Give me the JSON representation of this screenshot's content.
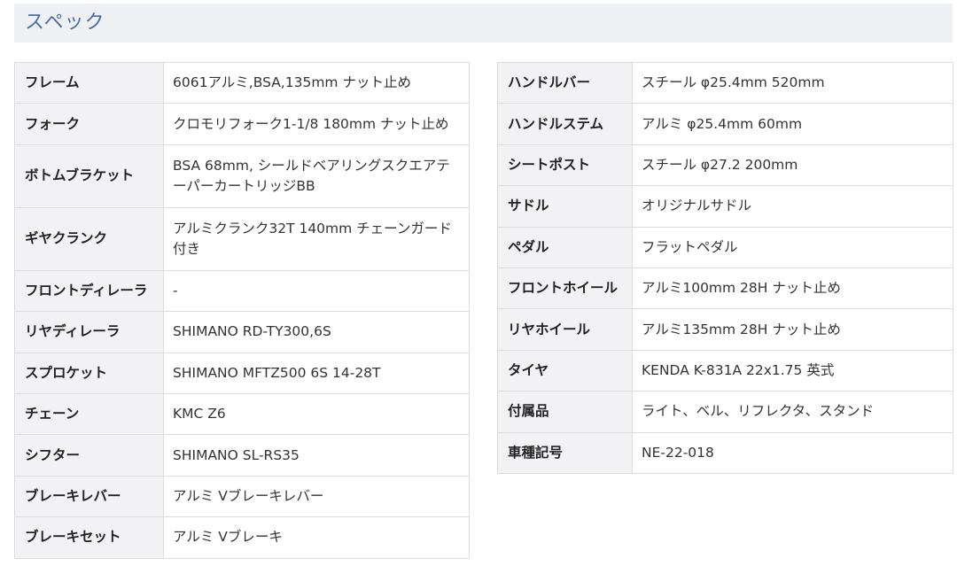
{
  "section": {
    "title": "スペック"
  },
  "left_table": [
    {
      "label": "フレーム",
      "value": "6061アルミ,BSA,135mm ナット止め"
    },
    {
      "label": "フォーク",
      "value": "クロモリフォーク1-1/8 180mm ナット止め"
    },
    {
      "label": "ボトムブラケット",
      "value": "BSA 68mm, シールドベアリングスクエアテーパーカートリッジBB"
    },
    {
      "label": "ギヤクランク",
      "value": "アルミクランク32T 140mm チェーンガード付き"
    },
    {
      "label": "フロントディレーラ",
      "value": "-"
    },
    {
      "label": "リヤディレーラ",
      "value": "SHIMANO RD-TY300,6S"
    },
    {
      "label": "スプロケット",
      "value": "SHIMANO MFTZ500 6S 14-28T"
    },
    {
      "label": "チェーン",
      "value": "KMC Z6"
    },
    {
      "label": "シフター",
      "value": "SHIMANO SL-RS35"
    },
    {
      "label": "ブレーキレバー",
      "value": "アルミ Vブレーキレバー"
    },
    {
      "label": "ブレーキセット",
      "value": "アルミ Vブレーキ"
    }
  ],
  "right_table": [
    {
      "label": "ハンドルバー",
      "value": "スチール φ25.4mm 520mm"
    },
    {
      "label": "ハンドルステム",
      "value": "アルミ φ25.4mm 60mm"
    },
    {
      "label": "シートポスト",
      "value": "スチール φ27.2 200mm"
    },
    {
      "label": "サドル",
      "value": "オリジナルサドル"
    },
    {
      "label": "ペダル",
      "value": "フラットペダル"
    },
    {
      "label": "フロントホイール",
      "value": "アルミ100mm 28H ナット止め"
    },
    {
      "label": "リヤホイール",
      "value": "アルミ135mm 28H ナット止め"
    },
    {
      "label": "タイヤ",
      "value": "KENDA K-831A 22x1.75 英式"
    },
    {
      "label": "付属品",
      "value": "ライト、ベル、リフレクタ、スタンド"
    },
    {
      "label": "車種記号",
      "value": "NE-22-018"
    }
  ]
}
